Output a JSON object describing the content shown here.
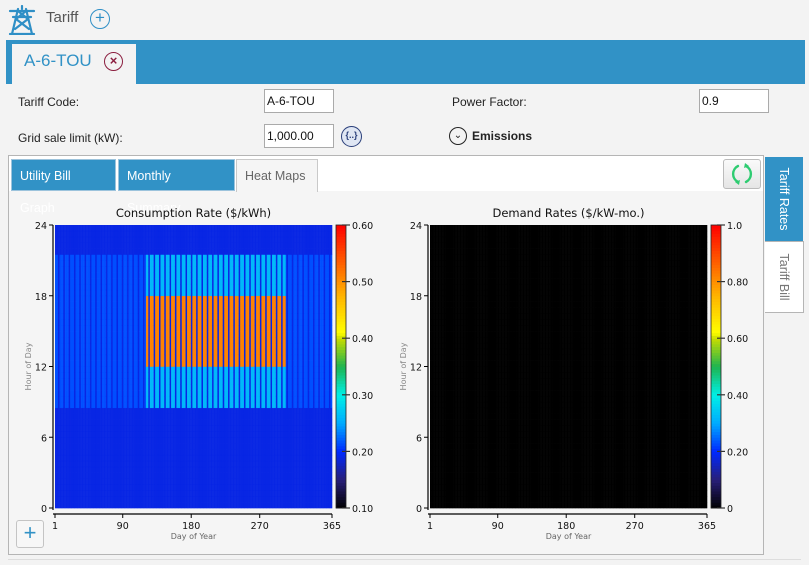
{
  "header": {
    "title": "Tariff",
    "icon": "transmission-tower-icon",
    "add_icon": "plus-circle-icon"
  },
  "document_tab": {
    "label": "A-6-TOU",
    "close_icon": "close-circle-icon"
  },
  "form": {
    "tariff_code_label": "Tariff Code:",
    "tariff_code_value": "A-6-TOU",
    "power_factor_label": "Power Factor:",
    "power_factor_value": "0.9",
    "grid_sale_limit_label": "Grid sale limit (kW):",
    "grid_sale_limit_value": "1,000.00",
    "expression_button_label": "{..}",
    "emissions_label": "Emissions"
  },
  "tabs": [
    {
      "label": "Utility Bill Graph",
      "active": false
    },
    {
      "label": "Monthly Summary",
      "active": false
    },
    {
      "label": "Heat Maps",
      "active": true
    }
  ],
  "side_tabs": [
    {
      "label": "Tariff Rates",
      "active": true
    },
    {
      "label": "Tariff Bill",
      "active": false
    }
  ],
  "zoom_button_label": "+",
  "colors": {
    "accent": "#3192c6",
    "close": "#8b1e3f",
    "refresh": "#2ecc71"
  },
  "chart_data": [
    {
      "type": "heatmap",
      "title": "Consumption Rate ($/kWh)",
      "xlabel": "Day of Year",
      "ylabel": "Hour of Day",
      "xlim": [
        1,
        365
      ],
      "ylim": [
        0,
        24
      ],
      "xticks": [
        "1",
        "90",
        "180",
        "270",
        "365"
      ],
      "yticks": [
        "0",
        "6",
        "12",
        "18",
        "24"
      ],
      "colorbar": {
        "range": [
          0.1,
          0.6
        ],
        "ticks": [
          "0.10",
          "0.20",
          "0.30",
          "0.40",
          "0.50",
          "0.60"
        ]
      },
      "rates": {
        "off_peak": 0.19,
        "winter_partial_peak": 0.215,
        "summer_partial_peak": 0.26,
        "summer_peak": 0.51
      },
      "periods": {
        "summer_days": [
          121,
          304
        ],
        "peak_hours": [
          12,
          18
        ],
        "partial_peak_hours": [
          8.5,
          21.5
        ],
        "weekends_off_peak": true
      }
    },
    {
      "type": "heatmap",
      "title": "Demand Rates ($/kW-mo.)",
      "xlabel": "Day of Year",
      "ylabel": "Hour of Day",
      "xlim": [
        1,
        365
      ],
      "ylim": [
        0,
        24
      ],
      "xticks": [
        "1",
        "90",
        "180",
        "270",
        "365"
      ],
      "yticks": [
        "0",
        "6",
        "12",
        "18",
        "24"
      ],
      "colorbar": {
        "range": [
          0,
          1.0
        ],
        "ticks": [
          "0",
          "0.20",
          "0.40",
          "0.60",
          "0.80",
          "1.0"
        ]
      },
      "values": "all zero (no demand rates)"
    }
  ]
}
